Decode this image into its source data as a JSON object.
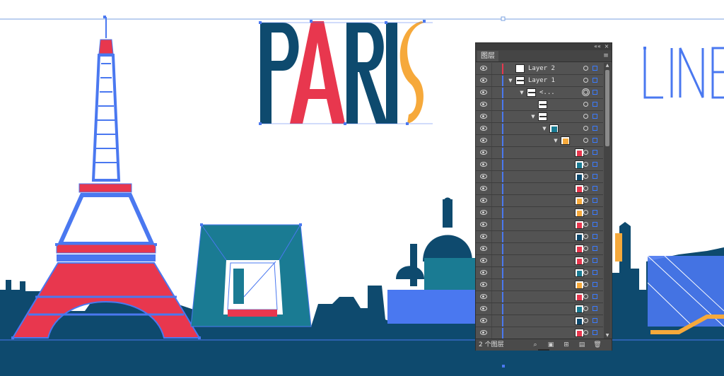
{
  "artwork": {
    "title": "PARIS",
    "title_letters": [
      "P",
      "A",
      "R",
      "I",
      "S"
    ],
    "partial_word": "LINE",
    "colors": {
      "navy": "#0e4a6e",
      "red": "#e8374e",
      "orange": "#f6a93b",
      "teal": "#1a7b93",
      "selection_blue": "#4a78f0",
      "background": "#ffffff"
    }
  },
  "panel": {
    "tab_label": "图层",
    "collapse_icon": "double-chevron-icon",
    "close_icon": "close-icon",
    "menu_icon": "panel-menu-icon",
    "rows": [
      {
        "type": "layer",
        "indent": 0,
        "expand": "",
        "thumb": "white",
        "name": "Layer 2",
        "bar": "#e8374e",
        "target": "single"
      },
      {
        "type": "layer",
        "indent": 0,
        "expand": "▼",
        "thumb": "bar",
        "name": "Layer 1",
        "bar": "#4a78f0",
        "target": "single"
      },
      {
        "type": "sublayer",
        "indent": 1,
        "expand": "▼",
        "thumb": "bar",
        "name": "<...",
        "bar": "#4a78f0",
        "target": "double"
      },
      {
        "type": "item",
        "indent": 2,
        "expand": "",
        "thumb": "bar",
        "name": "",
        "bar": "#4a78f0",
        "target": "single"
      },
      {
        "type": "item",
        "indent": 2,
        "expand": "▼",
        "thumb": "bar",
        "name": "",
        "bar": "#4a78f0",
        "target": "single"
      },
      {
        "type": "item",
        "indent": 3,
        "expand": "▼",
        "thumb": "city",
        "name": "",
        "bar": "#4a78f0",
        "target": "single"
      },
      {
        "type": "item",
        "indent": 4,
        "expand": "▼",
        "thumb": "orange",
        "name": "",
        "bar": "#4a78f0",
        "target": "single"
      },
      {
        "type": "path",
        "thumb_color": "#e8374e",
        "bar": "#4a78f0"
      },
      {
        "type": "path",
        "thumb_color": "#1a7b93",
        "bar": "#4a78f0"
      },
      {
        "type": "path",
        "thumb_color": "#0e4a6e",
        "bar": "#4a78f0"
      },
      {
        "type": "path",
        "thumb_color": "#e8374e",
        "bar": "#4a78f0"
      },
      {
        "type": "path",
        "thumb_color": "#f6a93b",
        "bar": "#4a78f0"
      },
      {
        "type": "path",
        "thumb_color": "#f6a93b",
        "bar": "#4a78f0"
      },
      {
        "type": "path",
        "thumb_color": "#e8374e",
        "bar": "#4a78f0"
      },
      {
        "type": "path",
        "thumb_color": "#0e4a6e",
        "bar": "#4a78f0"
      },
      {
        "type": "path",
        "thumb_color": "#e8374e",
        "bar": "#4a78f0"
      },
      {
        "type": "path",
        "thumb_color": "#e8374e",
        "bar": "#4a78f0"
      },
      {
        "type": "path",
        "thumb_color": "#1a7b93",
        "bar": "#4a78f0"
      },
      {
        "type": "path",
        "thumb_color": "#f6a93b",
        "bar": "#4a78f0"
      },
      {
        "type": "path",
        "thumb_color": "#e8374e",
        "bar": "#4a78f0"
      },
      {
        "type": "path",
        "thumb_color": "#1a7b93",
        "bar": "#4a78f0"
      },
      {
        "type": "path",
        "thumb_color": "#0e4a6e",
        "bar": "#4a78f0"
      },
      {
        "type": "path",
        "thumb_color": "#e8374e",
        "bar": "#4a78f0"
      },
      {
        "type": "path",
        "thumb_color": "#f6a93b",
        "bar": "#4a78f0"
      }
    ],
    "footer": {
      "layer_count": "2 个图层",
      "icons": [
        "locate-object-icon",
        "make-clipping-mask-icon",
        "new-sublayer-icon",
        "new-layer-icon",
        "delete-icon"
      ]
    }
  }
}
